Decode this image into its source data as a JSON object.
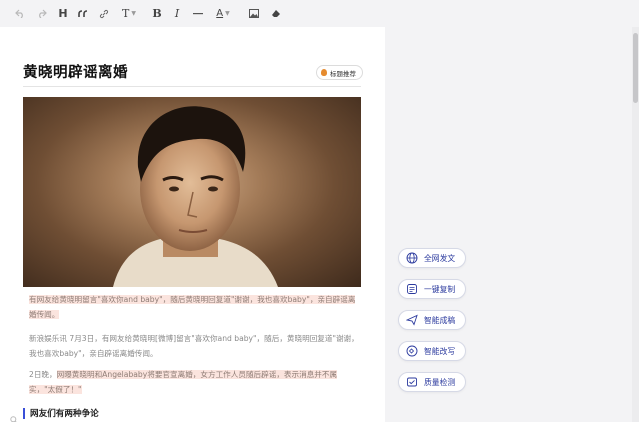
{
  "toolbar": {
    "heading_label": "H",
    "text_style_label": "T",
    "bold_label": "B",
    "italic_label": "I",
    "font_color_label": "A"
  },
  "article": {
    "title": "黄晓明辟谣离婚",
    "title_badge": "标题推荐",
    "para1_hl": "有网友给黄晓明留言\"喜欢你and baby\"，随后黄晓明回复道\"谢谢，我也喜欢baby\"，亲自辟谣离婚传闻。",
    "para2": "新浪娱乐讯 7月3日，有网友给黄晓明[微博]留言\"喜欢你and baby\"，随后，黄晓明回复道\"谢谢，我也喜欢baby\"，亲自辟谣离婚传闻。",
    "para3_a": "2日晚，",
    "para3_hl": "网曝黄晓明和Angelababy将要官宣离婚，女方工作人员随后辟谣，表示消息并不属实，\"太假了！\"",
    "subheading": "网友们有两种争论"
  },
  "ai_tools": [
    {
      "label": "全网发文",
      "icon": "globe-icon"
    },
    {
      "label": "一键复制",
      "icon": "copy-icon"
    },
    {
      "label": "智能成稿",
      "icon": "send-icon"
    },
    {
      "label": "智能改写",
      "icon": "rewrite-icon"
    },
    {
      "label": "质量检测",
      "icon": "check-icon"
    }
  ],
  "colors": {
    "accent": "#3a4fd8",
    "highlight": "#fbe4de",
    "ai_label": "#2b3a9e"
  }
}
